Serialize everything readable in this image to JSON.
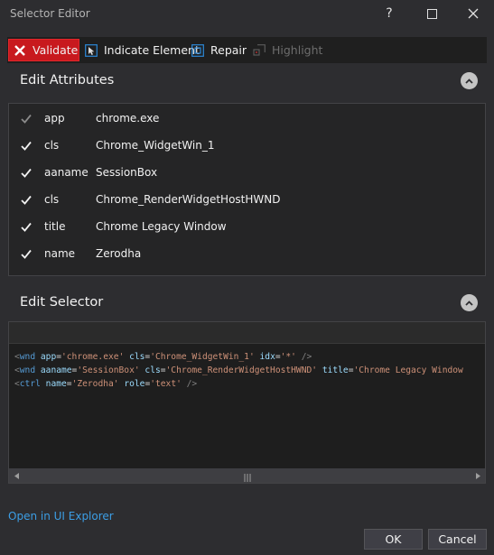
{
  "window": {
    "title": "Selector Editor",
    "help_label": "?",
    "icons": [
      "help-icon",
      "maximize-icon",
      "close-icon"
    ]
  },
  "toolbar": {
    "validate_label": "Validate",
    "indicate_label": "Indicate Element",
    "repair_label": "Repair",
    "highlight_label": "Highlight",
    "icons": [
      "x-icon",
      "pointer-icon",
      "target-icon",
      "highlight-icon"
    ],
    "validate_color": "#c8191e"
  },
  "edit_attributes": {
    "title": "Edit Attributes",
    "rows": [
      {
        "name": "app",
        "value": "chrome.exe",
        "checked": true,
        "enabled": false
      },
      {
        "name": "cls",
        "value": "Chrome_WidgetWin_1",
        "checked": true,
        "enabled": true
      },
      {
        "name": "aaname",
        "value": "SessionBox",
        "checked": true,
        "enabled": true
      },
      {
        "name": "cls",
        "value": "Chrome_RenderWidgetHostHWND",
        "checked": true,
        "enabled": true
      },
      {
        "name": "title",
        "value": "Chrome Legacy Window",
        "checked": true,
        "enabled": true
      },
      {
        "name": "name",
        "value": "Zerodha",
        "checked": true,
        "enabled": true
      }
    ]
  },
  "edit_selector": {
    "title": "Edit Selector",
    "lines": [
      {
        "tag": "wnd",
        "attrs": [
          [
            "app",
            "'chrome.exe'"
          ],
          [
            "cls",
            "'Chrome_WidgetWin_1'"
          ],
          [
            "idx",
            "'*'"
          ]
        ],
        "end": " />"
      },
      {
        "tag": "wnd",
        "attrs": [
          [
            "aaname",
            "'SessionBox'"
          ],
          [
            "cls",
            "'Chrome_RenderWidgetHostHWND'"
          ],
          [
            "title",
            "'Chrome Legacy Window"
          ]
        ],
        "end": ""
      },
      {
        "tag": "ctrl",
        "attrs": [
          [
            "name",
            "'Zerodha'"
          ],
          [
            "role",
            "'text'"
          ]
        ],
        "end": " />"
      }
    ]
  },
  "footer": {
    "link_label": "Open in UI Explorer",
    "ok_label": "OK",
    "cancel_label": "Cancel"
  }
}
